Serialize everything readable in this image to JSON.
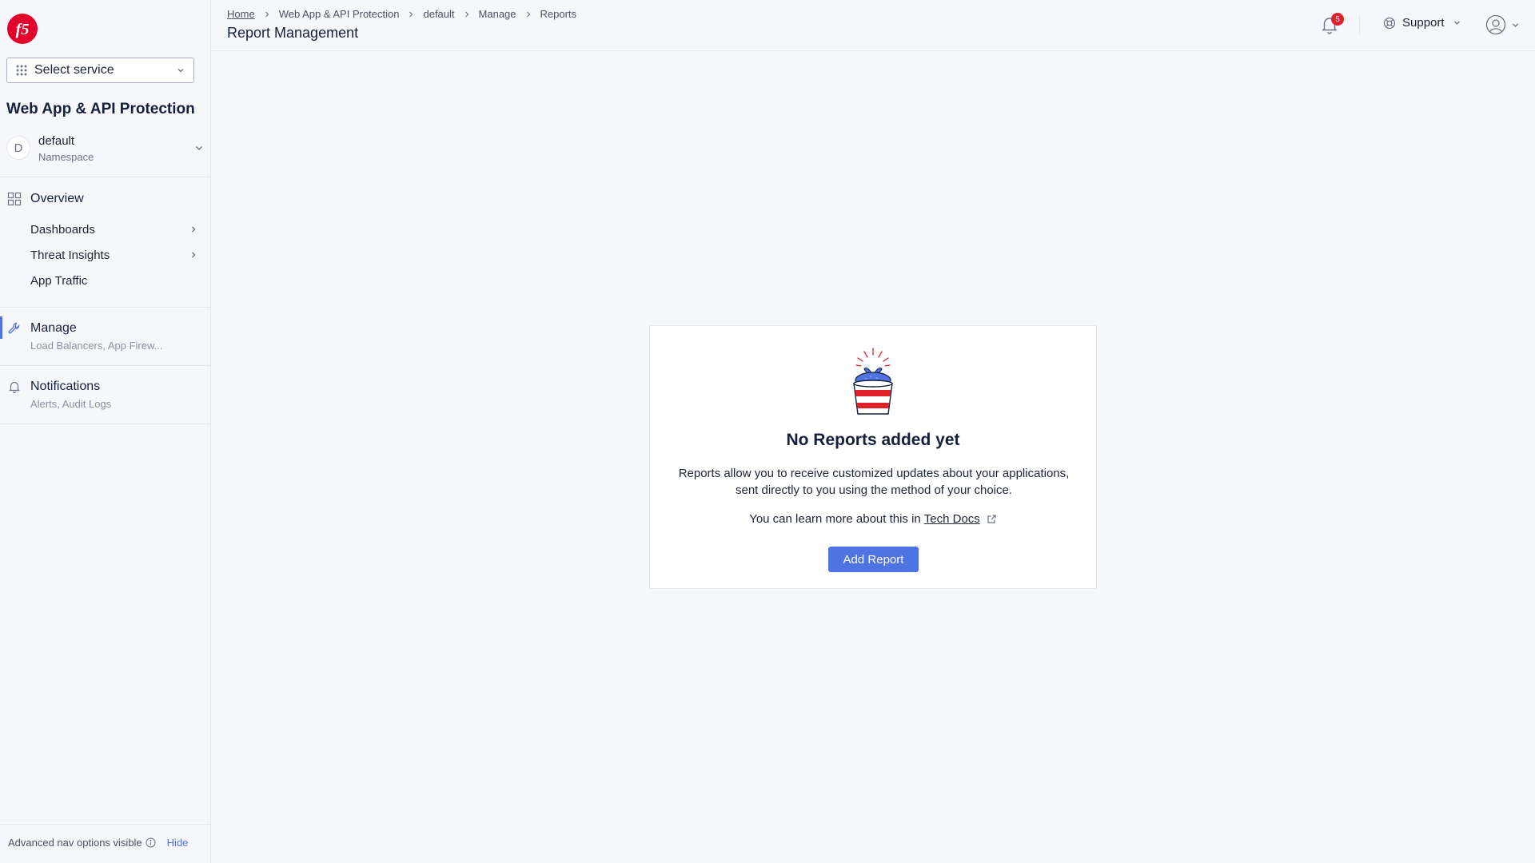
{
  "sidebar": {
    "service_select": "Select service",
    "app_title": "Web App & API Protection",
    "namespace": {
      "avatar": "D",
      "name": "default",
      "label": "Namespace"
    },
    "overview": {
      "label": "Overview",
      "items": [
        {
          "label": "Dashboards",
          "has_children": true
        },
        {
          "label": "Threat Insights",
          "has_children": true
        },
        {
          "label": "App Traffic",
          "has_children": false
        }
      ]
    },
    "manage": {
      "label": "Manage",
      "sub": "Load Balancers, App Firew..."
    },
    "notifications": {
      "label": "Notifications",
      "sub": "Alerts, Audit Logs"
    },
    "footer": {
      "text": "Advanced nav options visible",
      "hide": "Hide"
    }
  },
  "header": {
    "breadcrumb": [
      "Home",
      "Web App & API Protection",
      "default",
      "Manage",
      "Reports"
    ],
    "title": "Report Management",
    "notification_count": "5",
    "support": "Support"
  },
  "empty_state": {
    "title": "No Reports added yet",
    "description": "Reports allow you to receive customized updates about your applications, sent directly to you using the method of your choice.",
    "learn_prefix": "You can learn more about this in",
    "learn_link": "Tech Docs",
    "button": "Add Report"
  },
  "colors": {
    "accent": "#4f73e3",
    "badge": "#e0212c",
    "brand": "#e4002b"
  }
}
